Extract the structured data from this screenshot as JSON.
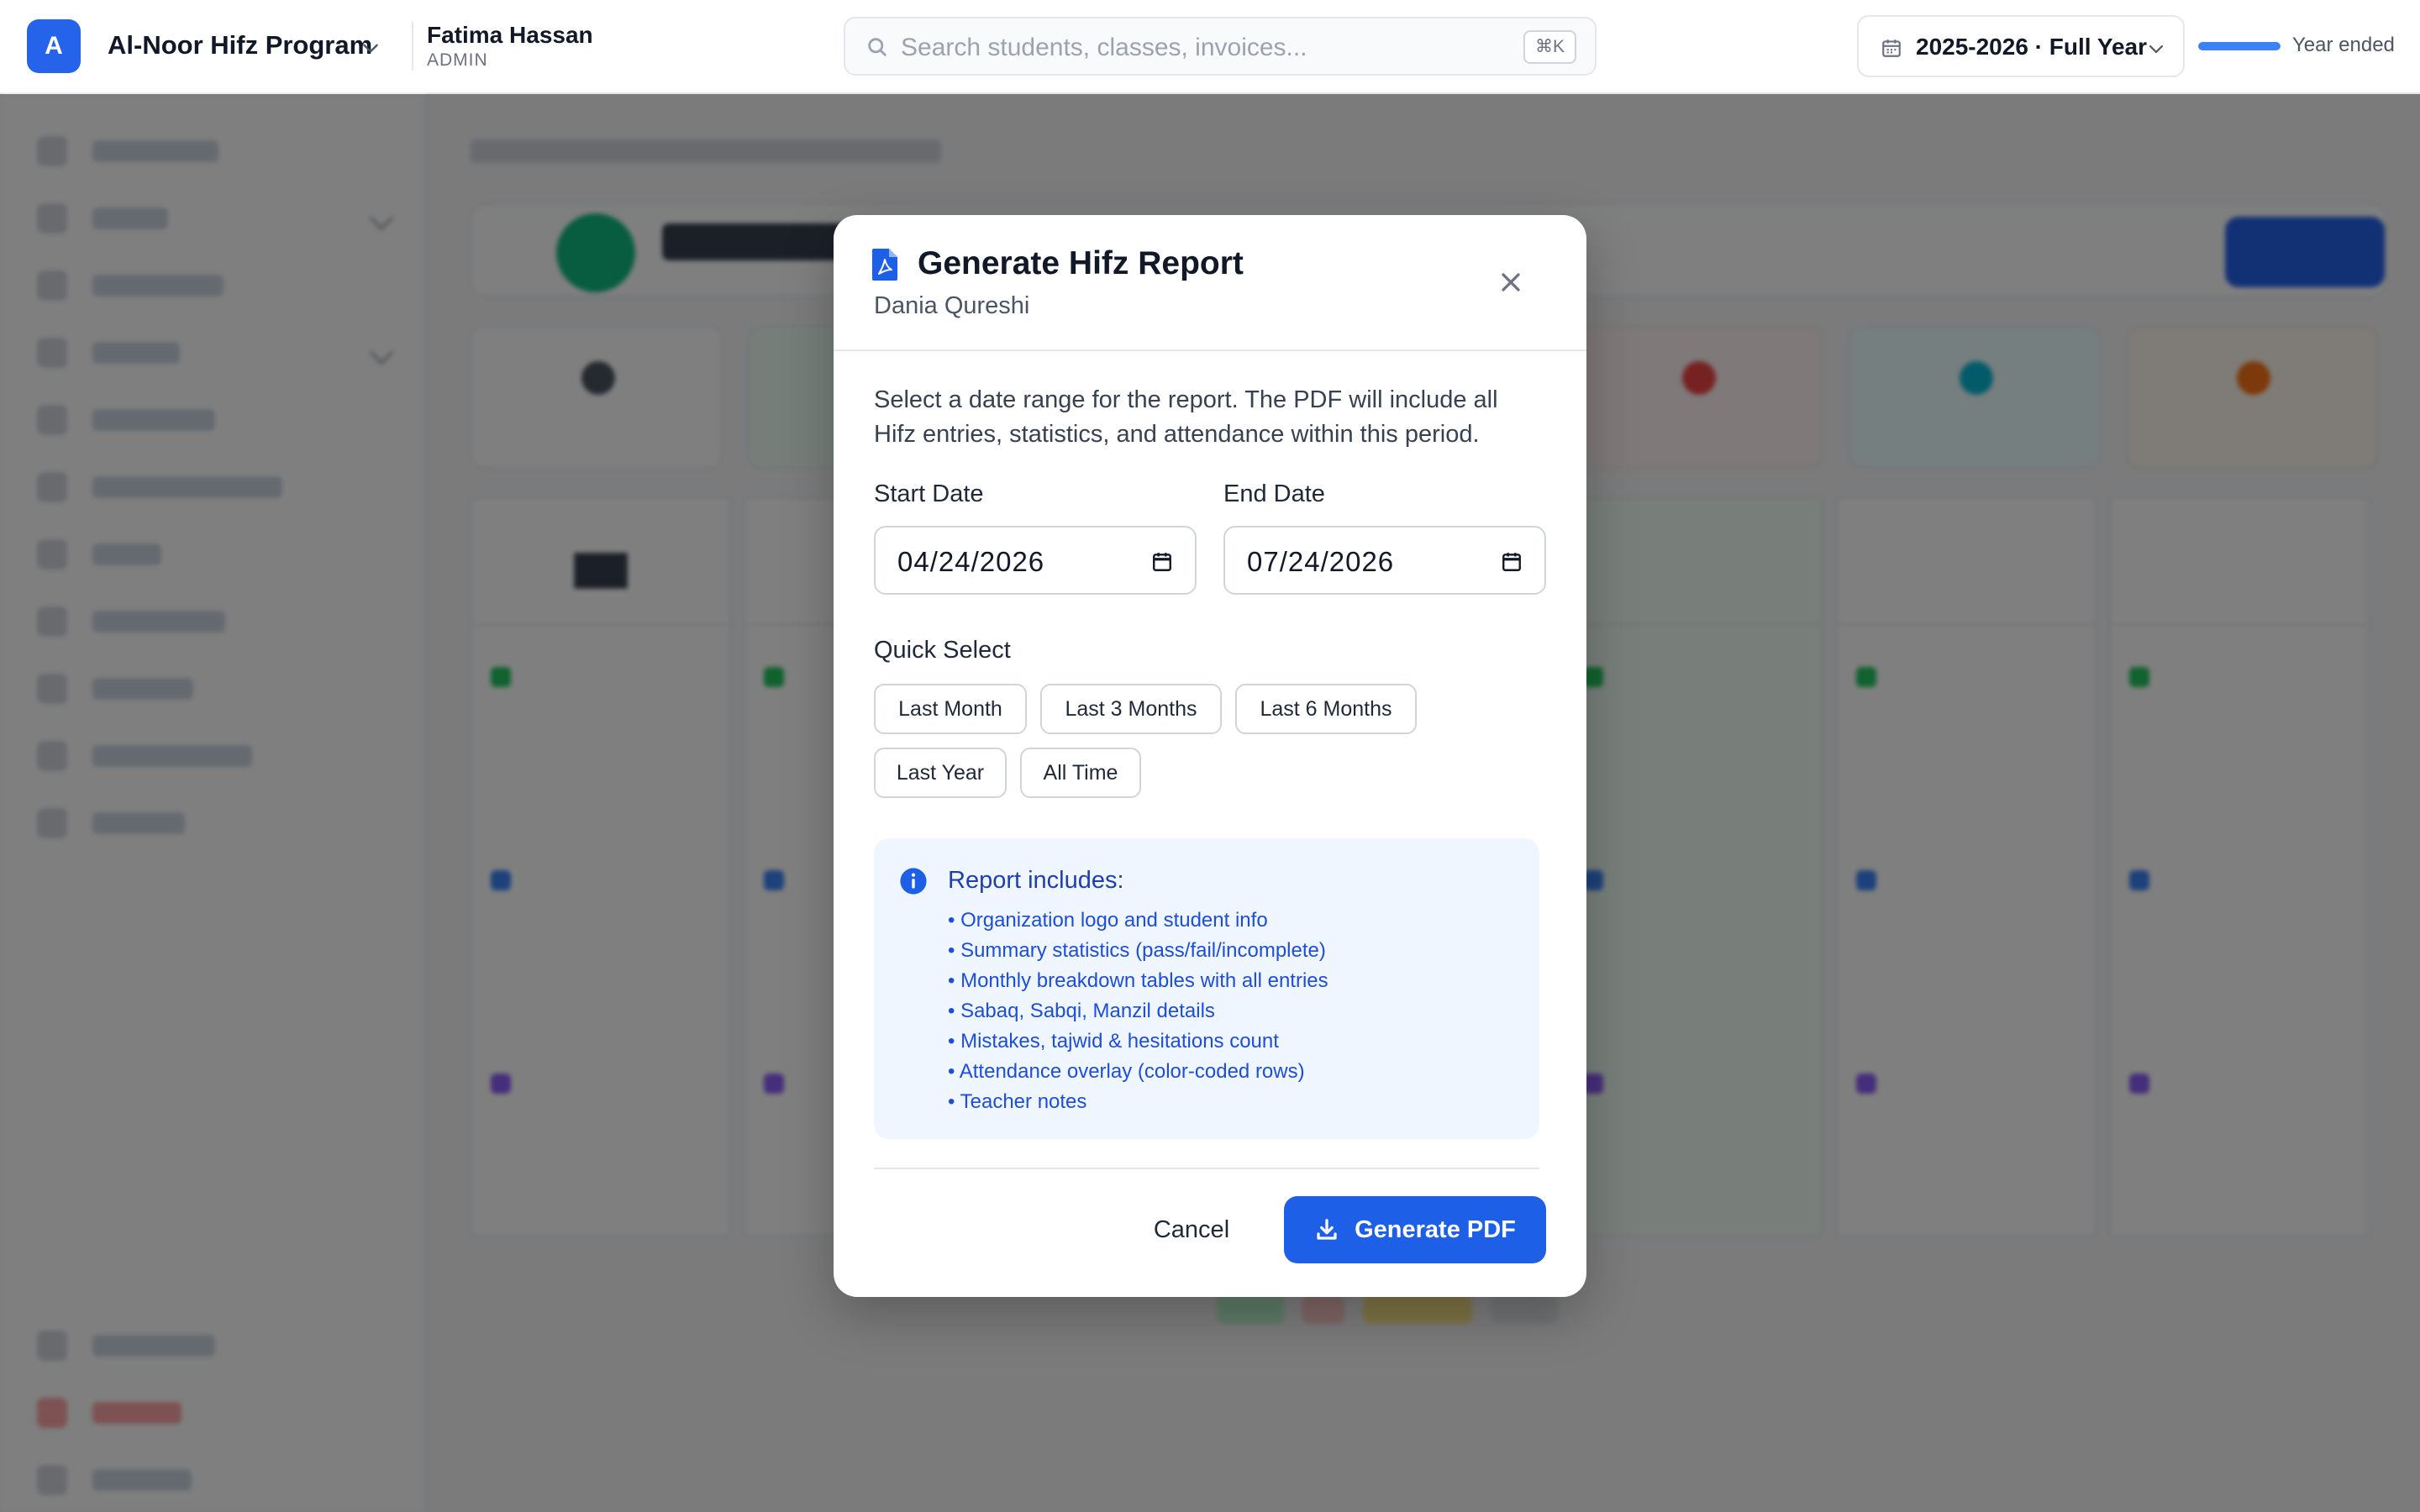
{
  "topbar": {
    "org_initial": "A",
    "org_name": "Al-Noor Hifz Program",
    "user_name": "Fatima Hassan",
    "user_role": "ADMIN",
    "search_placeholder": "Search students, classes, invoices...",
    "search_shortcut": "⌘K",
    "academic_year": "2025-2026 · Full Year",
    "year_progress_percent": 100,
    "year_status": "Year ended"
  },
  "modal": {
    "title": "Generate Hifz Report",
    "subtitle": "Dania Qureshi",
    "description": "Select a date range for the report. The PDF will include all Hifz entries, statistics, and attendance within this period.",
    "start_label": "Start Date",
    "start_value": "04/24/2026",
    "end_label": "End Date",
    "end_value": "07/24/2026",
    "quick_select_label": "Quick Select",
    "quick_options": [
      "Last Month",
      "Last 3 Months",
      "Last 6 Months",
      "Last Year",
      "All Time"
    ],
    "info_title": "Report includes:",
    "info_items": [
      "• Organization logo and student info",
      "• Summary statistics (pass/fail/incomplete)",
      "• Monthly breakdown tables with all entries",
      "• Sabaq, Sabqi, Manzil details",
      "• Mistakes, tajwid & hesitations count",
      "• Attendance overlay (color-coded rows)",
      "• Teacher notes"
    ],
    "cancel_label": "Cancel",
    "generate_label": "Generate PDF"
  },
  "colors": {
    "primary": "#2563eb",
    "info_bg": "#eff6ff",
    "info_text": "#1d4ed8"
  }
}
